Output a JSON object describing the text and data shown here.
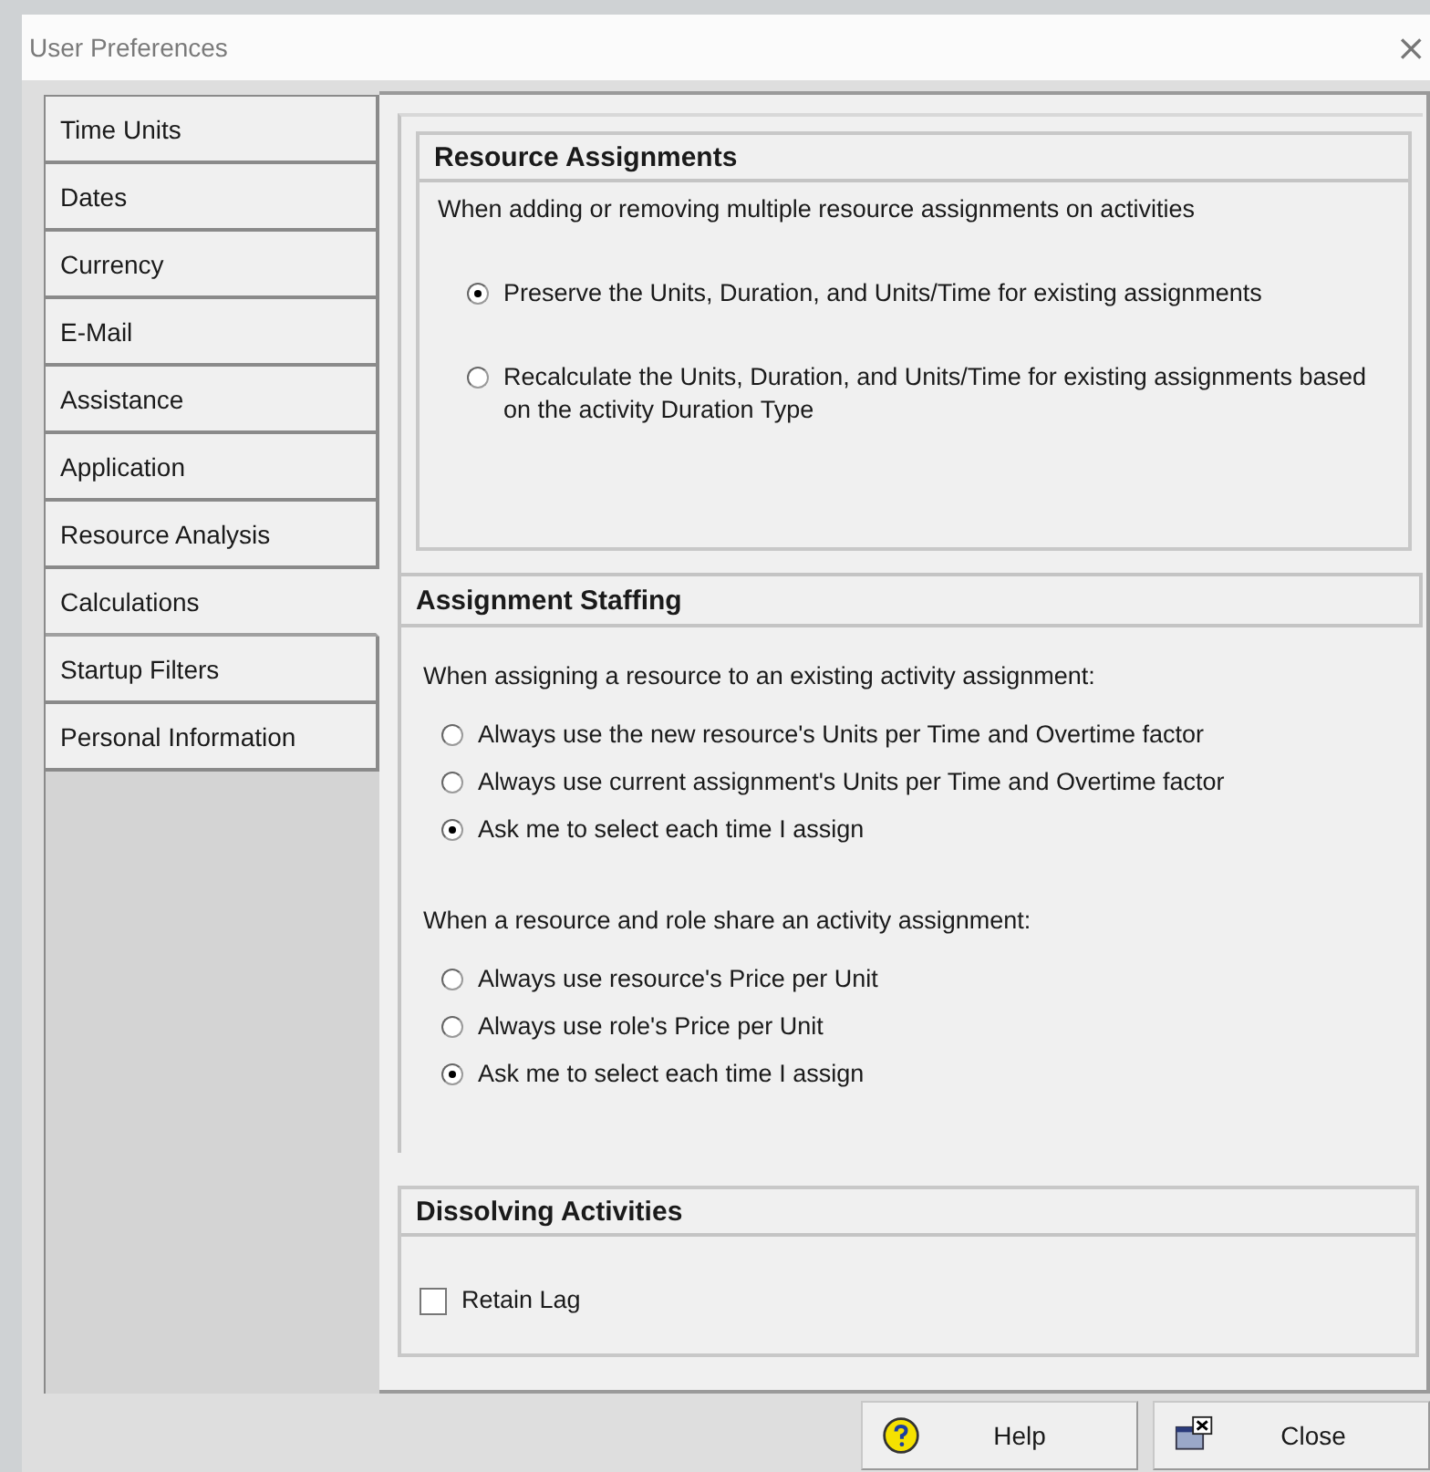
{
  "window": {
    "title": "User Preferences",
    "close": "×"
  },
  "sidebar": {
    "items": [
      {
        "label": "Time Units",
        "selected": false
      },
      {
        "label": "Dates",
        "selected": false
      },
      {
        "label": "Currency",
        "selected": false
      },
      {
        "label": "E-Mail",
        "selected": false
      },
      {
        "label": "Assistance",
        "selected": false
      },
      {
        "label": "Application",
        "selected": false
      },
      {
        "label": "Resource Analysis",
        "selected": false
      },
      {
        "label": "Calculations",
        "selected": true
      },
      {
        "label": "Startup Filters",
        "selected": false
      },
      {
        "label": "Personal Information",
        "selected": false
      }
    ]
  },
  "resource_assignments": {
    "title": "Resource Assignments",
    "prompt": "When adding or removing multiple resource assignments on activities",
    "options": [
      {
        "label": "Preserve the Units, Duration, and Units/Time for existing assignments",
        "selected": true
      },
      {
        "label": "Recalculate the Units, Duration, and Units/Time for existing assignments based on the activity Duration Type",
        "selected": false
      }
    ]
  },
  "assignment_staffing": {
    "title": "Assignment Staffing",
    "groups": [
      {
        "prompt": "When assigning a resource to an existing activity assignment:",
        "options": [
          {
            "label": "Always use the new resource's Units per Time and Overtime factor",
            "selected": false
          },
          {
            "label": "Always use current assignment's Units per Time and Overtime factor",
            "selected": false
          },
          {
            "label": "Ask me to select each time I assign",
            "selected": true
          }
        ]
      },
      {
        "prompt": "When a resource and role share an activity assignment:",
        "options": [
          {
            "label": "Always use resource's Price per Unit",
            "selected": false
          },
          {
            "label": "Always use role's Price per Unit",
            "selected": false
          },
          {
            "label": "Ask me to select each time I assign",
            "selected": true
          }
        ]
      }
    ]
  },
  "dissolving_activities": {
    "title": "Dissolving Activities",
    "checkboxes": [
      {
        "label": "Retain Lag",
        "checked": false
      }
    ]
  },
  "buttons": [
    {
      "label": "Help",
      "kind": "help"
    },
    {
      "label": "Close",
      "kind": "close"
    }
  ]
}
